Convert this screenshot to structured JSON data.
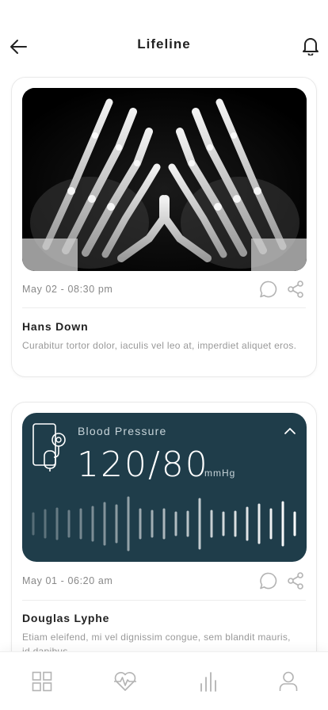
{
  "header": {
    "title": "Lifeline"
  },
  "posts": [
    {
      "date": "May 02 - 08:30 pm",
      "author": "Hans Down",
      "text": "Curabitur tortor dolor, iaculis vel leo at, imperdiet aliquet eros."
    },
    {
      "date": "May 01 - 06:20 am",
      "author": "Douglas Lyphe",
      "text": "Etiam eleifend, mi vel dignissim congue, sem blandit mauris, id dapibus",
      "reading": {
        "label": "Blood Pressure",
        "value": "120/80",
        "unit": "mmHg"
      }
    }
  ],
  "colors": {
    "panel": "#1f3d4a",
    "text": "#222222",
    "muted": "#999999",
    "icon": "#b3b3b3"
  },
  "icons": {
    "back": "arrow-left-icon",
    "bell": "bell-icon",
    "comment": "chat-bubble-icon",
    "share": "share-icon",
    "collapse": "chevron-up-icon",
    "tabs": [
      "grid-icon",
      "heartbeat-icon",
      "bar-chart-icon",
      "user-icon"
    ]
  }
}
